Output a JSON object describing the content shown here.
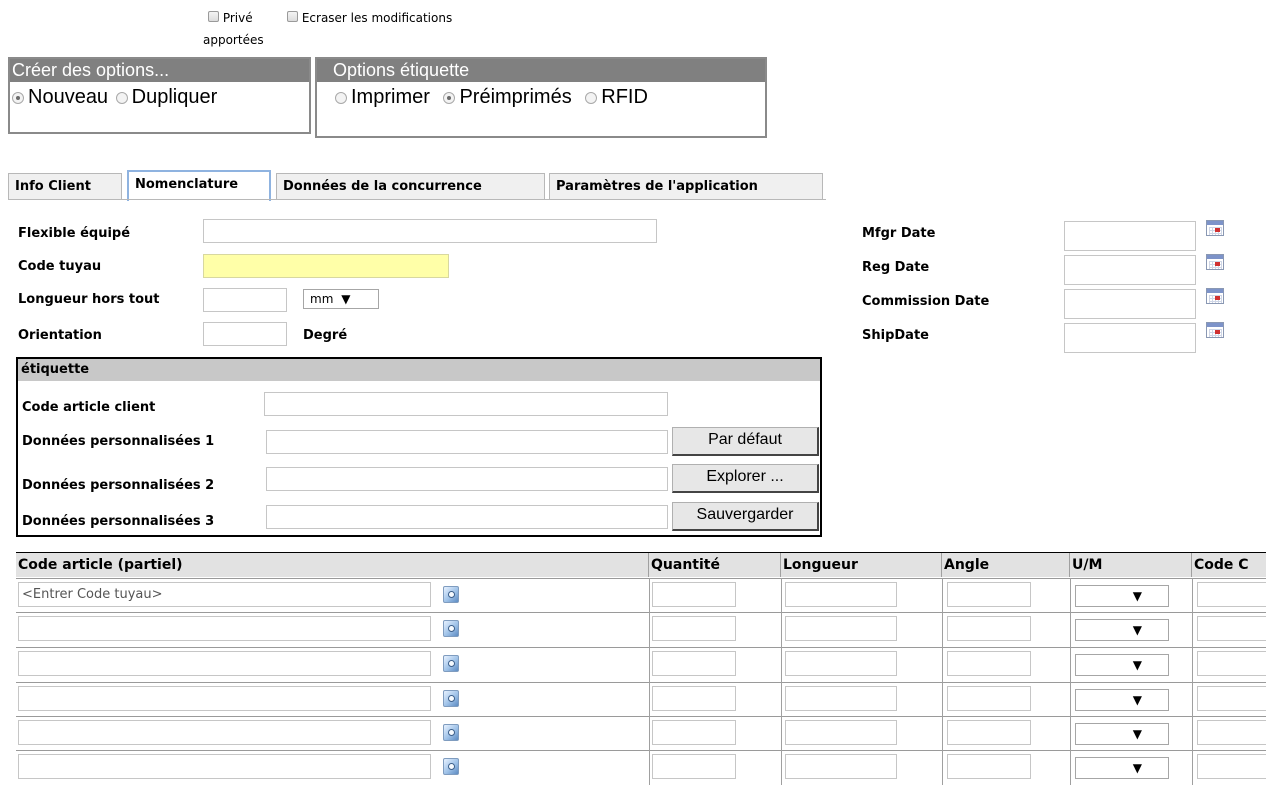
{
  "top": {
    "prive_label": "Privé",
    "ecraser_label": "Ecraser les modifications",
    "ecraser_label2": "apportées"
  },
  "creer_options": {
    "title": "Créer des options...",
    "options": [
      "Nouveau",
      "Dupliquer"
    ],
    "selected": "Nouveau"
  },
  "options_etiquette": {
    "title": "Options étiquette",
    "options": [
      "Imprimer",
      "Préimprimés",
      "RFID"
    ],
    "selected": "Préimprimés"
  },
  "tabs": [
    "Info Client",
    "Nomenclature",
    "Données de la concurrence",
    "Paramètres de l'application"
  ],
  "active_tab": "Nomenclature",
  "form": {
    "flexible_label": "Flexible équipé",
    "code_tuyau_label": "Code tuyau",
    "longueur_label": "Longueur hors tout",
    "unit_value": "mm",
    "orientation_label": "Orientation",
    "degre_label": "Degré",
    "mfgr_label": "Mfgr Date",
    "reg_label": "Reg Date",
    "commission_label": "Commission Date",
    "ship_label": "ShipDate"
  },
  "etiquette": {
    "title": "étiquette",
    "code_article_client": "Code article client",
    "perso1": "Données personnalisées 1",
    "perso2": "Données personnalisées 2",
    "perso3": "Données personnalisées 3",
    "btn_defaut": "Par défaut",
    "btn_explorer": "Explorer ...",
    "btn_sauvegarder": "Sauvergarder"
  },
  "grid": {
    "headers": [
      "Code article (partiel)",
      "Quantité",
      "Longueur",
      "Angle",
      "U/M",
      "Code C"
    ],
    "first_row_placeholder": "<Entrer Code tuyau>",
    "dropdown_arrow": "▼"
  }
}
